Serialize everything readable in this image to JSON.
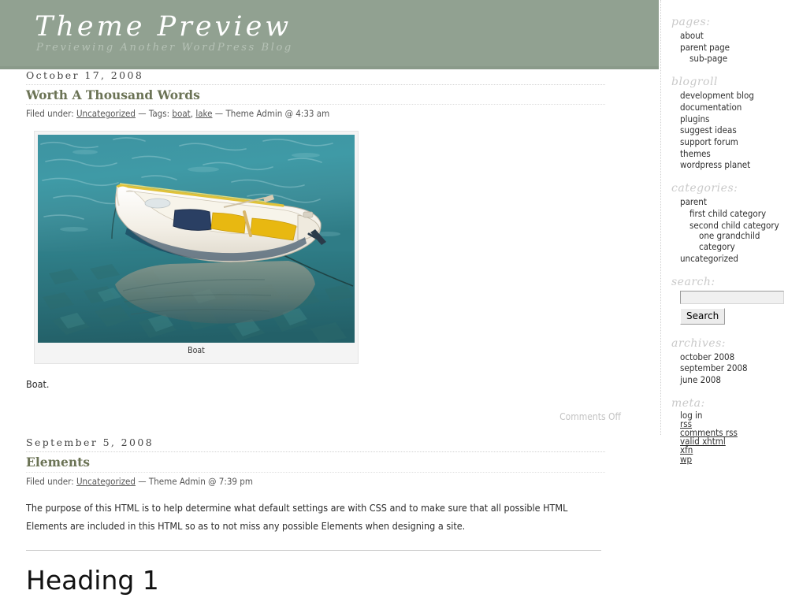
{
  "header": {
    "title": "Theme Preview",
    "description": "Previewing Another WordPress Blog"
  },
  "posts": [
    {
      "date": "October 17, 2008",
      "title": "Worth A Thousand Words",
      "meta_prefix": "Filed under:",
      "category": "Uncategorized",
      "sep1": "—",
      "tags_label": "Tags:",
      "tag1": "boat",
      "tag_comma": ",",
      "tag2": "lake",
      "sep2": "—",
      "author_time": "Theme Admin @ 4:33 am",
      "image_caption": "Boat",
      "body": "Boat.",
      "comments": "Comments Off"
    },
    {
      "date": "September 5, 2008",
      "title": "Elements",
      "meta_prefix": "Filed under:",
      "category": "Uncategorized",
      "sep1": "—",
      "author_time": "Theme Admin @ 7:39 pm",
      "body": "The purpose of this HTML is to help determine what default settings are with CSS and to make sure that all possible HTML Elements are included in this HTML so as to not miss any possible Elements when designing a site.",
      "heading1": "Heading 1"
    }
  ],
  "sidebar": {
    "pages": {
      "heading": "pages:",
      "items": [
        {
          "label": "about",
          "level": 0
        },
        {
          "label": "parent page",
          "level": 0
        },
        {
          "label": "sub-page",
          "level": 1
        }
      ]
    },
    "blogroll": {
      "heading": "blogroll",
      "items": [
        {
          "label": "development blog",
          "level": 0
        },
        {
          "label": "documentation",
          "level": 0
        },
        {
          "label": "plugins",
          "level": 0
        },
        {
          "label": "suggest ideas",
          "level": 0
        },
        {
          "label": "support forum",
          "level": 0
        },
        {
          "label": "themes",
          "level": 0
        },
        {
          "label": "wordpress planet",
          "level": 0
        }
      ]
    },
    "categories": {
      "heading": "categories:",
      "items": [
        {
          "label": "parent",
          "level": 0
        },
        {
          "label": "first child category",
          "level": 1
        },
        {
          "label": "second child category",
          "level": 1
        },
        {
          "label": "one grandchild category",
          "level": 2,
          "wrap": true
        },
        {
          "label": "uncategorized",
          "level": 0
        }
      ]
    },
    "search": {
      "heading": "search:",
      "value": "",
      "placeholder": "",
      "button_label": "Search"
    },
    "archives": {
      "heading": "archives:",
      "items": [
        {
          "label": "october 2008",
          "level": 0
        },
        {
          "label": "september 2008",
          "level": 0
        },
        {
          "label": "june 2008",
          "level": 0
        }
      ]
    },
    "meta": {
      "heading": "meta:",
      "items": [
        {
          "label": "log in",
          "level": 0
        },
        {
          "label": "rss",
          "level": 0
        },
        {
          "label": "comments rss",
          "level": 0
        },
        {
          "label": "valid xhtml",
          "level": 0
        },
        {
          "label": "xfn",
          "level": 0
        },
        {
          "label": "wp",
          "level": 0
        }
      ]
    }
  },
  "colors": {
    "header_green": "#91a191",
    "title_olive": "#6b7355",
    "sidebar_heading_gray": "#c9c9c9",
    "comments_gray": "#c3c3c3"
  }
}
